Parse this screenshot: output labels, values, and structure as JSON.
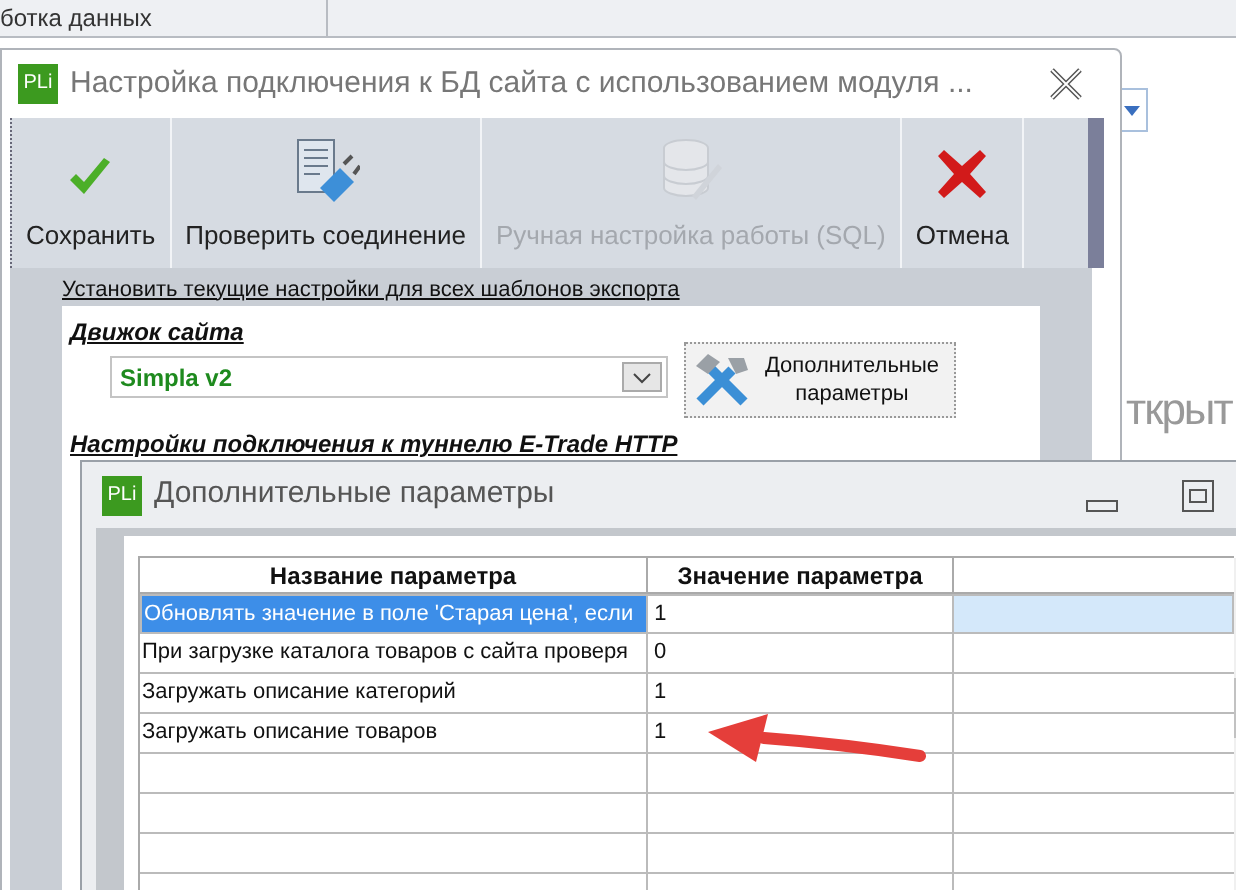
{
  "background_app": {
    "tab_label": "ботка данных",
    "partial_text": "ткрыт"
  },
  "main_window": {
    "app_icon": "PLi",
    "title": "Настройка подключения к БД сайта с использованием модуля ...",
    "toolbar": [
      {
        "label": "Сохранить",
        "kind": "save",
        "disabled": false
      },
      {
        "label": "Проверить соединение",
        "kind": "test",
        "disabled": false
      },
      {
        "label": "Ручная настройка работы (SQL)",
        "kind": "sql",
        "disabled": true
      },
      {
        "label": "Отмена",
        "kind": "cancel",
        "disabled": false
      }
    ],
    "apply_link": "Установить текущие настройки для всех шаблонов экспорта",
    "engine_label": "Движок сайта",
    "engine_value": "Simpla v2",
    "extra_button": "Дополнительные параметры",
    "tunnel_label": "Настройки подключения к туннелю E-Trade HTTP"
  },
  "dialog": {
    "app_icon": "PLi",
    "title": "Дополнительные параметры",
    "table": {
      "columns": [
        "Название параметра",
        "Значение параметра"
      ],
      "rows": [
        {
          "name": "Обновлять значение в поле 'Старая цена', если",
          "value": "1",
          "selected": true
        },
        {
          "name": "При загрузке каталога товаров с сайта проверя",
          "value": "0",
          "selected": false
        },
        {
          "name": "Загружать описание категорий",
          "value": "1",
          "selected": false
        },
        {
          "name": "Загружать описание товаров",
          "value": "1",
          "selected": false
        }
      ]
    }
  }
}
